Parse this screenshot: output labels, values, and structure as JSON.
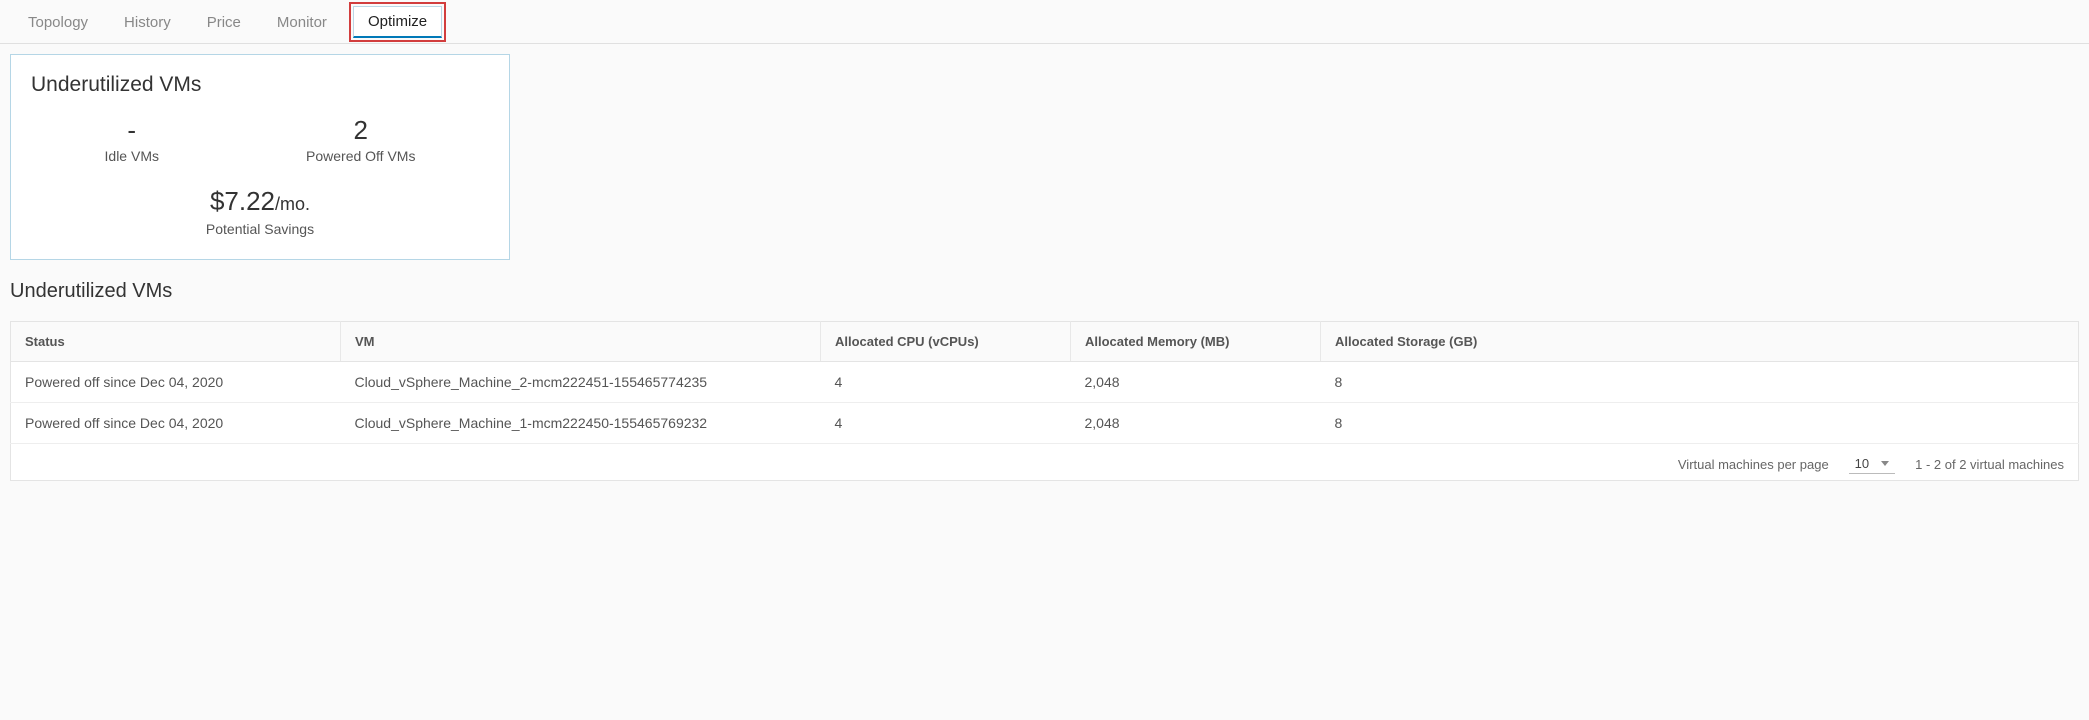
{
  "tabs": {
    "topology": "Topology",
    "history": "History",
    "price": "Price",
    "monitor": "Monitor",
    "optimize": "Optimize"
  },
  "card": {
    "title": "Underutilized VMs",
    "idle_value": "-",
    "idle_label": "Idle VMs",
    "off_value": "2",
    "off_label": "Powered Off VMs",
    "savings_amount": "$7.22",
    "savings_unit": "/mo.",
    "savings_label": "Potential Savings"
  },
  "section_title": "Underutilized VMs",
  "table": {
    "headers": {
      "status": "Status",
      "vm": "VM",
      "cpu": "Allocated CPU (vCPUs)",
      "mem": "Allocated Memory (MB)",
      "storage": "Allocated Storage (GB)"
    },
    "rows": [
      {
        "status": "Powered off since Dec 04, 2020",
        "vm": "Cloud_vSphere_Machine_2-mcm222451-155465774235",
        "cpu": "4",
        "mem": "2,048",
        "storage": "8"
      },
      {
        "status": "Powered off since Dec 04, 2020",
        "vm": "Cloud_vSphere_Machine_1-mcm222450-155465769232",
        "cpu": "4",
        "mem": "2,048",
        "storage": "8"
      }
    ]
  },
  "footer": {
    "per_page_label": "Virtual machines per page",
    "per_page_value": "10",
    "range": "1 - 2 of 2 virtual machines"
  }
}
